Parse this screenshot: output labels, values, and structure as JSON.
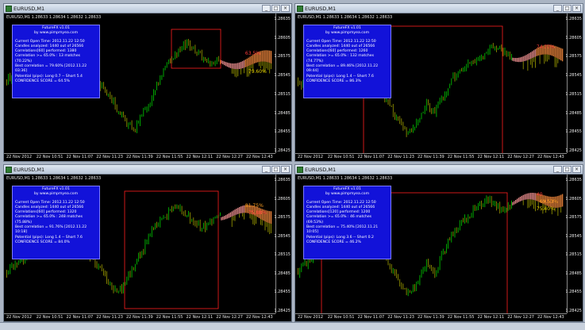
{
  "colors": {
    "bull": "#00d000",
    "bear": "#a0a000",
    "bg": "#000000",
    "rect": "#ff2020",
    "panel": "#1212d9",
    "proj_a": "#ff9a9a",
    "proj_b": "#ff9040",
    "label_red": "#ff3b3b",
    "label_orange": "#ff9f20",
    "label_yellow": "#e8d400"
  },
  "icons": {
    "window": "chart-window-icon",
    "minimize": "minimize-icon",
    "maximize": "maximize-icon",
    "close": "close-icon"
  },
  "windows": [
    {
      "title": "EURUSD,M1",
      "quote": "EURUSD,M1 1.28633 1.28634 1.28632 1.28633",
      "price_labels": [
        "1.28635",
        "1.28605",
        "1.28575",
        "1.28545",
        "1.28515",
        "1.28485",
        "1.28455",
        "1.28425"
      ],
      "time_labels": [
        "22 Nov 2012",
        "22 Nov 10:51",
        "22 Nov 11:07",
        "22 Nov 11:23",
        "22 Nov 11:39",
        "22 Nov 11:55",
        "22 Nov 12:11",
        "22 Nov 12:27",
        "22 Nov 12:43"
      ],
      "panel": [
        "FutureFX v1.01",
        "by www.pimpmyea.com",
        "",
        "Current Open Time: 2012.11.22 12:50",
        "Candles analyzed: 1440 out of 26566",
        "Correlations[60] performed: 1380",
        "Correlation >= 65.0% : 13 matches (70.22%)",
        "Best correlation = 79.60% [2012.11.22 03:36]",
        "Potential (pips): Long 0.7 -- Short 5.4",
        "CONFIDENCE SCORE = 64.5%"
      ],
      "proj_labels": [
        {
          "text": "63.5%",
          "color": "#ff3b3b"
        },
        {
          "text": "79.60%",
          "color": "#e8d400"
        }
      ]
    },
    {
      "title": "EURUSD,M1",
      "quote": "EURUSD,M1 1.28633 1.28634 1.28632 1.28633",
      "price_labels": [
        "1.28635",
        "1.28605",
        "1.28575",
        "1.28545",
        "1.28515",
        "1.28485",
        "1.28455",
        "1.28425"
      ],
      "time_labels": [
        "22 Nov 2012",
        "22 Nov 10:51",
        "22 Nov 11:07",
        "22 Nov 11:23",
        "22 Nov 11:39",
        "22 Nov 11:55",
        "22 Nov 12:11",
        "22 Nov 12:27",
        "22 Nov 12:43"
      ],
      "panel": [
        "FutureFX v1.01",
        "by www.pimpmyea.com",
        "",
        "Current Open Time: 2012.11.22 12:50",
        "Candles analyzed: 1440 out of 26566",
        "Correlations[60] performed: 1260",
        "Correlation >= 65.0% : 132 matches (74.77%)",
        "Best correlation = 89.46% [2012.11.22 09:44]",
        "Potential (pips): Long 1.4 -- Short 7.6",
        "CONFIDENCE SCORE = 86.3%"
      ],
      "proj_labels": [
        {
          "text": "74.77%",
          "color": "#ff3b3b"
        }
      ]
    },
    {
      "title": "EURUSD,M1",
      "quote": "EURUSD,M1 1.28633 1.28634 1.28632 1.28633",
      "price_labels": [
        "1.28635",
        "1.28605",
        "1.28575",
        "1.28545",
        "1.28515",
        "1.28485",
        "1.28455",
        "1.28425"
      ],
      "time_labels": [
        "22 Nov 2012",
        "22 Nov 10:51",
        "22 Nov 11:07",
        "22 Nov 11:23",
        "22 Nov 11:39",
        "22 Nov 11:55",
        "22 Nov 12:11",
        "22 Nov 12:27",
        "22 Nov 12:43"
      ],
      "panel": [
        "FutureFX v1.01",
        "by www.pimpmyea.com",
        "",
        "Current Open Time: 2012.11.22 12:50",
        "Candles analyzed: 1440 out of 26566",
        "Correlations[60] performed: 1320",
        "Correlation >= 65.0% : 248 matches (75.88%)",
        "Best correlation = 91.76% [2012.11.22 10:18]",
        "Potential (pips): Long 1.4 -- Short 7.6",
        "CONFIDENCE SCORE = 84.0%"
      ],
      "proj_labels": [
        {
          "text": "81.75%",
          "color": "#ff9f20"
        },
        {
          "text": "75.88%",
          "color": "#ff3b3b"
        }
      ]
    },
    {
      "title": "EURUSD,M1",
      "quote": "EURUSD,M1 1.28633 1.28634 1.28632 1.28633",
      "price_labels": [
        "1.28635",
        "1.28605",
        "1.28575",
        "1.28545",
        "1.28515",
        "1.28485",
        "1.28455",
        "1.28425"
      ],
      "time_labels": [
        "22 Nov 2012",
        "22 Nov 10:51",
        "22 Nov 11:07",
        "22 Nov 11:23",
        "22 Nov 11:39",
        "22 Nov 11:55",
        "22 Nov 12:11",
        "22 Nov 12:27",
        "22 Nov 12:43"
      ],
      "panel": [
        "FutureFX v1.01",
        "by www.pimpmyea.com",
        "",
        "Current Open Time: 2012.11.22 12:50",
        "Candles analyzed: 1440 out of 26566",
        "Correlations[120] performed: 1200",
        "Correlation >= 65.0% : 46 matches (69.53%)",
        "Best correlation = 75.40% [2012.11.21 10:05]",
        "Potential (pips): Long 3.6 -- Short 0.2",
        "CONFIDENCE SCORE = 46.2%"
      ],
      "proj_labels": [
        {
          "text": "40",
          "color": "#ff3b3b"
        },
        {
          "text": "69.53%",
          "color": "#ff9f20"
        },
        {
          "text": "75.40%",
          "color": "#e8d400"
        }
      ]
    }
  ]
}
